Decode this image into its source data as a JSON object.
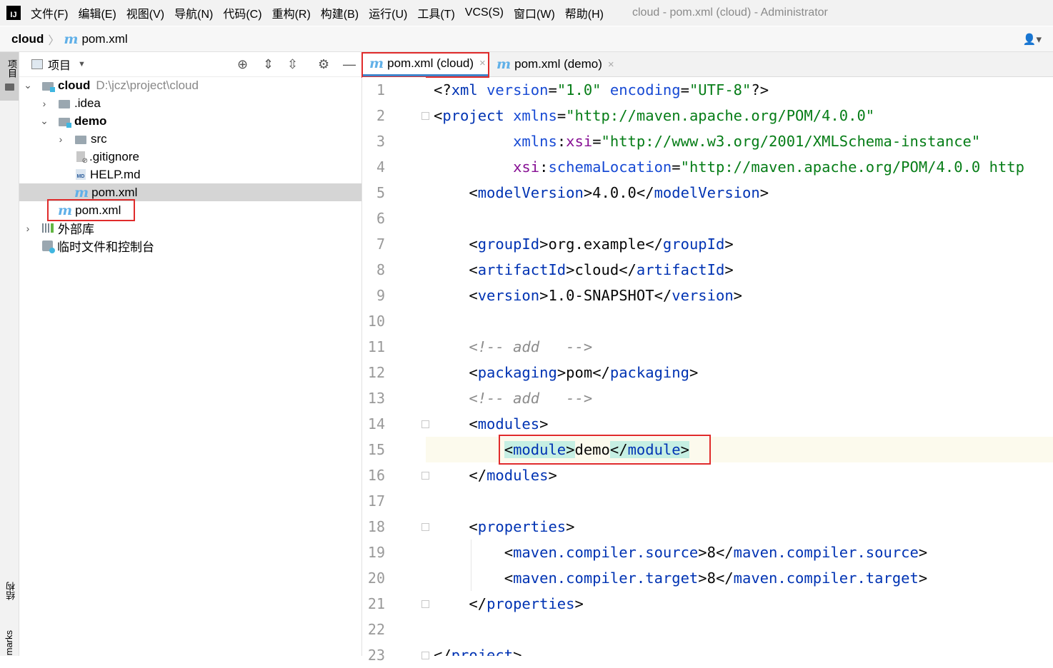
{
  "menubar": {
    "logo": "IJ",
    "items": [
      "文件(F)",
      "编辑(E)",
      "视图(V)",
      "导航(N)",
      "代码(C)",
      "重构(R)",
      "构建(B)",
      "运行(U)",
      "工具(T)",
      "VCS(S)",
      "窗口(W)",
      "帮助(H)"
    ],
    "window_title": "cloud - pom.xml (cloud) - Administrator"
  },
  "breadcrumb": {
    "root": "cloud",
    "file_icon": "m",
    "file": "pom.xml",
    "separator": "〉"
  },
  "left_stripe": {
    "project": "项目",
    "structure": "结构",
    "bookmarks": "marks"
  },
  "project_panel": {
    "title": "项目",
    "tree": [
      {
        "label": "cloud",
        "path": "D:\\jcz\\project\\cloud"
      },
      {
        "label": ".idea"
      },
      {
        "label": "demo"
      },
      {
        "label": "src"
      },
      {
        "label": ".gitignore"
      },
      {
        "label": "HELP.md",
        "icon_text": "MD"
      },
      {
        "label": "pom.xml",
        "icon_text": "m"
      },
      {
        "label": "pom.xml",
        "icon_text": "m"
      },
      {
        "label": "外部库"
      },
      {
        "label": "临时文件和控制台"
      }
    ]
  },
  "editor": {
    "tabs": [
      {
        "icon": "m",
        "label": "pom.xml (cloud)",
        "active": true
      },
      {
        "icon": "m",
        "label": "pom.xml (demo)",
        "active": false
      }
    ],
    "line_numbers": [
      "1",
      "2",
      "3",
      "4",
      "5",
      "6",
      "7",
      "8",
      "9",
      "10",
      "11",
      "12",
      "13",
      "14",
      "15",
      "16",
      "17",
      "18",
      "19",
      "20",
      "21",
      "22",
      "23"
    ],
    "code": {
      "l1": {
        "open": "<?",
        "tag": "xml",
        "a1": "version",
        "v1": "\"1.0\"",
        "a2": "encoding",
        "v2": "\"UTF-8\"",
        "close": "?>"
      },
      "l2": {
        "tag": "project",
        "attr": "xmlns",
        "val": "\"http://maven.apache.org/POM/4.0.0\""
      },
      "l3": {
        "ns": "xmlns",
        "attr": "xsi",
        "val": "\"http://www.w3.org/2001/XMLSchema-instance\""
      },
      "l4": {
        "ns": "xsi",
        "attr": "schemaLocation",
        "val": "\"http://maven.apache.org/POM/4.0.0 http"
      },
      "l5": {
        "tag": "modelVersion",
        "text": "4.0.0"
      },
      "l7": {
        "tag": "groupId",
        "text": "org.example"
      },
      "l8": {
        "tag": "artifactId",
        "text": "cloud"
      },
      "l9": {
        "tag": "version",
        "text": "1.0-SNAPSHOT"
      },
      "l11": "<!-- add   -->",
      "l12": {
        "tag": "packaging",
        "text": "pom"
      },
      "l13": "<!-- add   -->",
      "l14": {
        "tag": "modules"
      },
      "l15": {
        "tag": "module",
        "text": "demo"
      },
      "l16": {
        "tag": "modules"
      },
      "l18": {
        "tag": "properties"
      },
      "l19": {
        "tag": "maven.compiler.source",
        "text": "8"
      },
      "l20": {
        "tag": "maven.compiler.target",
        "text": "8"
      },
      "l21": {
        "tag": "properties"
      },
      "l23": {
        "tag": "project"
      }
    }
  },
  "colors": {
    "tag": "#0033b3",
    "value": "#067d17",
    "namespace": "#871094",
    "comment": "#8c8c8c",
    "highlight_box": "#e02b2b"
  }
}
